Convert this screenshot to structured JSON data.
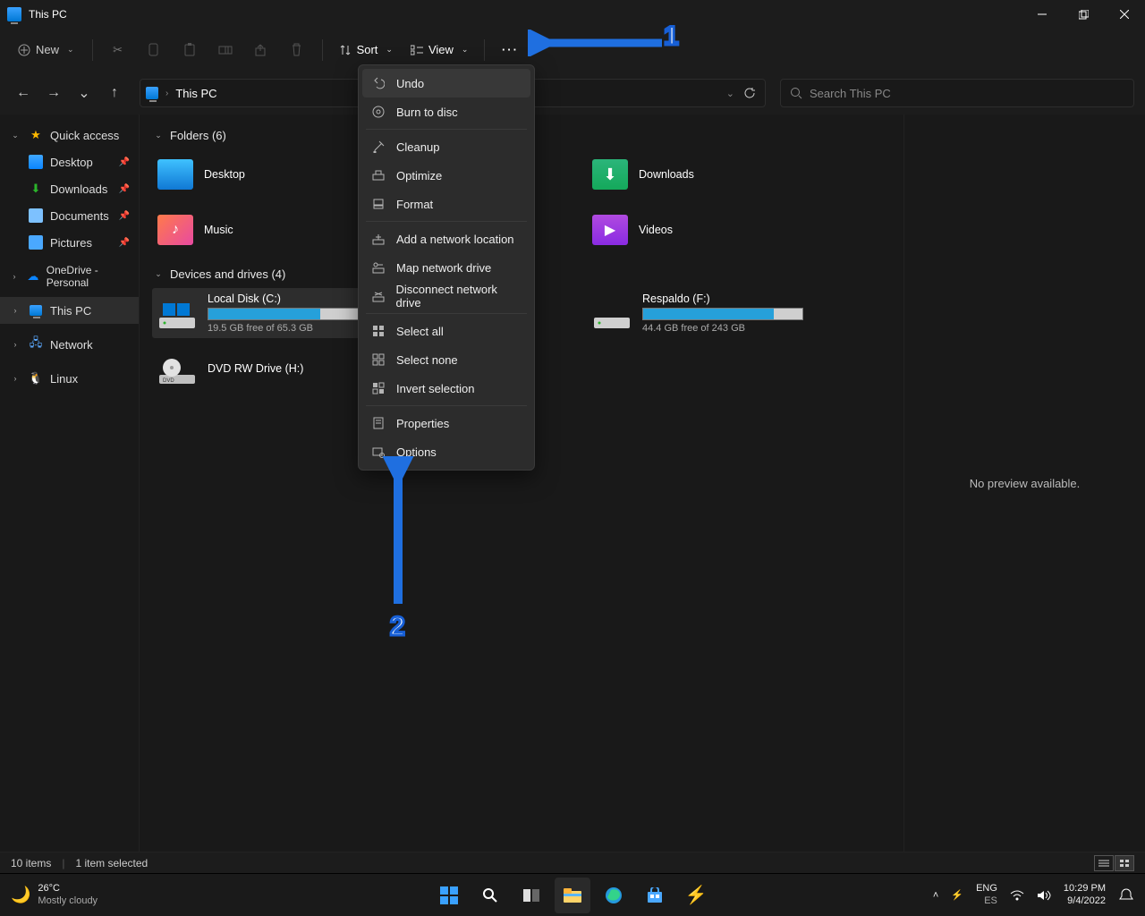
{
  "title": "This PC",
  "toolbar": {
    "new_label": "New",
    "sort_label": "Sort",
    "view_label": "View"
  },
  "context_menu": [
    "Undo",
    "Burn to disc",
    "-",
    "Cleanup",
    "Optimize",
    "Format",
    "-",
    "Add a network location",
    "Map network drive",
    "Disconnect network drive",
    "-",
    "Select all",
    "Select none",
    "Invert selection",
    "-",
    "Properties",
    "Options"
  ],
  "breadcrumb": {
    "location": "This PC"
  },
  "search": {
    "placeholder": "Search This PC"
  },
  "sidebar": {
    "quick_access": "Quick access",
    "items": [
      "Desktop",
      "Downloads",
      "Documents",
      "Pictures"
    ],
    "onedrive": "OneDrive - Personal",
    "thispc": "This PC",
    "network": "Network",
    "linux": "Linux"
  },
  "groups": {
    "folders": {
      "label": "Folders (6)",
      "items": [
        "Desktop",
        "Downloads",
        "Music",
        "Videos"
      ]
    },
    "drives": {
      "label": "Devices and drives (4)",
      "items": [
        {
          "name": "Local Disk (C:)",
          "free": "19.5 GB free of 65.3 GB",
          "pct": 70
        },
        {
          "name": "Respaldo (F:)",
          "free": "44.4 GB free of 243 GB",
          "pct": 82
        },
        {
          "name": "DVD RW Drive (H:)",
          "type": "dvd"
        }
      ]
    }
  },
  "preview": {
    "text": "No preview available."
  },
  "status": {
    "items": "10 items",
    "sel": "1 item selected"
  },
  "taskbar": {
    "temp": "26°C",
    "weather": "Mostly cloudy",
    "lang1": "ENG",
    "lang2": "ES",
    "time": "10:29 PM",
    "date": "9/4/2022"
  },
  "annotations": {
    "one": "1",
    "two": "2"
  }
}
